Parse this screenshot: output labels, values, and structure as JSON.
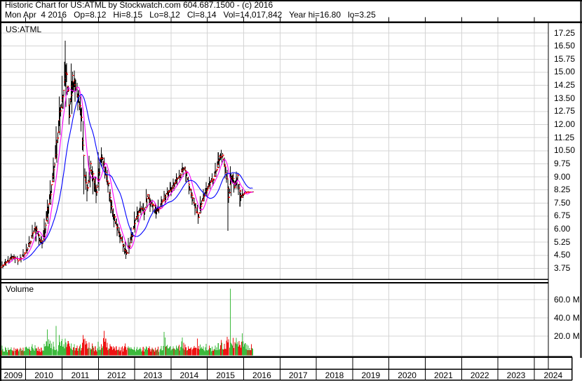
{
  "header": {
    "line1": "Historic Chart for US:ATML by Stockwatch.com 604.687.1500 - (c) 2016",
    "line2": "Mon Apr  4 2016   Op=8.12   Hi=8.15   Lo=8.12   Cl=8.14   Vol=14,017,842   Year hi=16.80   lo=3.25"
  },
  "price_pane": {
    "symbol_label": "US:ATML"
  },
  "volume_pane": {
    "label": "Volume"
  },
  "axes": {
    "price_ticks": [
      "17.25",
      "16.50",
      "15.75",
      "15.00",
      "14.25",
      "13.50",
      "12.75",
      "12.00",
      "11.25",
      "10.50",
      "9.75",
      "9.00",
      "8.25",
      "7.50",
      "6.75",
      "6.00",
      "5.25",
      "4.50",
      "3.75"
    ],
    "volume_ticks": [
      "60.0 M",
      "40.0 M",
      "20.0 M"
    ],
    "years": [
      "2009",
      "2010",
      "2011",
      "2012",
      "2013",
      "2014",
      "2015",
      "2016",
      "2017",
      "2018",
      "2019",
      "2020",
      "2021",
      "2022",
      "2023",
      "2024"
    ]
  },
  "colors": {
    "grid": "#d4d4d4",
    "border": "#000000",
    "bar": "#000000",
    "open_close_tick": "#ff0000",
    "ma_fast": "#ff00ff",
    "ma_slow": "#0000ff",
    "vol_up": "#3cb93c",
    "vol_down": "#ee1111",
    "background": "#ffffff"
  },
  "chart_data": {
    "type": "candlestick+volume",
    "symbol": "US:ATML",
    "title": "Historic Chart for US:ATML",
    "period": "weekly bars, Apr 2009 - Apr 2016",
    "x_axis": {
      "years_shown": [
        2009,
        2010,
        2011,
        2012,
        2013,
        2014,
        2015,
        2016,
        2017,
        2018,
        2019,
        2020,
        2021,
        2022,
        2023,
        2024
      ],
      "data_start_year_fraction": 2009.33,
      "data_end_year_fraction": 2016.26
    },
    "price_axis": {
      "min_label": 3.75,
      "max_label": 17.25,
      "step": 0.75
    },
    "volume_axis": {
      "ticks_millions": [
        20,
        40,
        60
      ]
    },
    "months_per_point": 1,
    "series": {
      "close": [
        3.95,
        4.1,
        4.25,
        4.4,
        4.3,
        4.2,
        4.35,
        4.6,
        4.9,
        5.3,
        5.9,
        6.1,
        5.4,
        5.2,
        6.2,
        7.3,
        8.4,
        9.7,
        11.3,
        12.9,
        13.9,
        15.2,
        12.6,
        14.6,
        14.2,
        13.5,
        12.3,
        9.0,
        8.2,
        9.6,
        8.8,
        8.1,
        9.9,
        10.2,
        9.3,
        8.5,
        7.3,
        6.6,
        6.0,
        5.6,
        5.0,
        4.55,
        5.1,
        5.7,
        6.6,
        6.9,
        7.2,
        7.0,
        7.9,
        7.5,
        7.3,
        7.0,
        7.3,
        7.6,
        7.9,
        8.1,
        8.3,
        8.6,
        8.9,
        9.1,
        9.5,
        9.2,
        8.4,
        7.8,
        7.2,
        6.7,
        7.5,
        8.0,
        8.35,
        8.7,
        8.9,
        9.4,
        10.1,
        10.25,
        9.3,
        7.8,
        9.1,
        8.5,
        9.0,
        7.8,
        8.05,
        8.12,
        8.13,
        8.14
      ],
      "high": [
        4.15,
        4.3,
        4.45,
        4.6,
        4.55,
        4.45,
        4.55,
        4.85,
        5.15,
        5.6,
        6.25,
        6.4,
        5.9,
        5.6,
        6.6,
        7.7,
        8.8,
        10.1,
        11.9,
        13.6,
        14.8,
        16.8,
        14.2,
        15.5,
        15.1,
        14.4,
        13.6,
        12.2,
        9.3,
        10.2,
        9.6,
        9.0,
        10.4,
        10.7,
        10.1,
        9.4,
        8.3,
        7.2,
        6.6,
        6.1,
        5.6,
        5.3,
        5.5,
        6.1,
        7.0,
        7.3,
        7.6,
        7.5,
        8.3,
        8.0,
        7.7,
        7.5,
        7.7,
        7.9,
        8.2,
        8.4,
        8.7,
        8.9,
        9.2,
        9.4,
        9.8,
        9.6,
        9.0,
        8.3,
        7.8,
        7.4,
        7.9,
        8.3,
        8.7,
        9.0,
        9.2,
        9.8,
        10.4,
        10.55,
        10.1,
        9.4,
        9.6,
        9.2,
        9.3,
        8.6,
        8.3,
        8.2,
        8.18,
        8.16
      ],
      "low": [
        3.75,
        3.9,
        4.05,
        4.15,
        4.05,
        3.95,
        4.1,
        4.35,
        4.6,
        4.95,
        5.45,
        5.3,
        5.05,
        4.9,
        5.3,
        6.3,
        7.4,
        8.7,
        9.8,
        11.4,
        12.9,
        13.0,
        12.0,
        12.6,
        13.3,
        12.8,
        11.6,
        8.0,
        7.6,
        8.4,
        8.0,
        7.5,
        8.2,
        9.5,
        8.9,
        8.1,
        6.9,
        6.1,
        5.6,
        5.2,
        4.7,
        4.3,
        4.6,
        5.2,
        5.8,
        6.4,
        6.8,
        6.5,
        7.2,
        7.0,
        6.9,
        6.6,
        6.9,
        7.2,
        7.5,
        7.7,
        7.9,
        8.2,
        8.5,
        8.7,
        9.0,
        8.7,
        8.0,
        7.4,
        6.8,
        6.3,
        6.9,
        7.6,
        7.9,
        8.3,
        8.5,
        9.0,
        9.5,
        9.7,
        8.9,
        5.9,
        7.9,
        8.1,
        8.3,
        7.3,
        7.8,
        8.02,
        8.08,
        8.1
      ],
      "volume_peak_millions": [
        10,
        9,
        8,
        9,
        8,
        7,
        8,
        8,
        10,
        9,
        12,
        10,
        9,
        8,
        12,
        28,
        16,
        14,
        31,
        24,
        20,
        18,
        16,
        14,
        12,
        10,
        12,
        22,
        16,
        14,
        12,
        10,
        14,
        12,
        27,
        14,
        12,
        10,
        9,
        9,
        10,
        12,
        10,
        9,
        8,
        9,
        8,
        9,
        10,
        9,
        8,
        8,
        9,
        10,
        25,
        12,
        10,
        9,
        10,
        12,
        20,
        12,
        10,
        9,
        10,
        18,
        12,
        10,
        12,
        10,
        9,
        10,
        14,
        16,
        12,
        22,
        72,
        20,
        18,
        16,
        26,
        14,
        10,
        12
      ]
    },
    "moving_averages": [
      {
        "color": "#ff00ff",
        "period_weeks": 10
      },
      {
        "color": "#0000ff",
        "period_weeks": 30
      }
    ],
    "last_trade": {
      "date": "Mon Apr 4 2016",
      "open": 8.12,
      "high": 8.15,
      "low": 8.12,
      "close": 8.14,
      "volume": "14,017,842",
      "year_high": 16.8,
      "year_low": 3.25
    }
  }
}
